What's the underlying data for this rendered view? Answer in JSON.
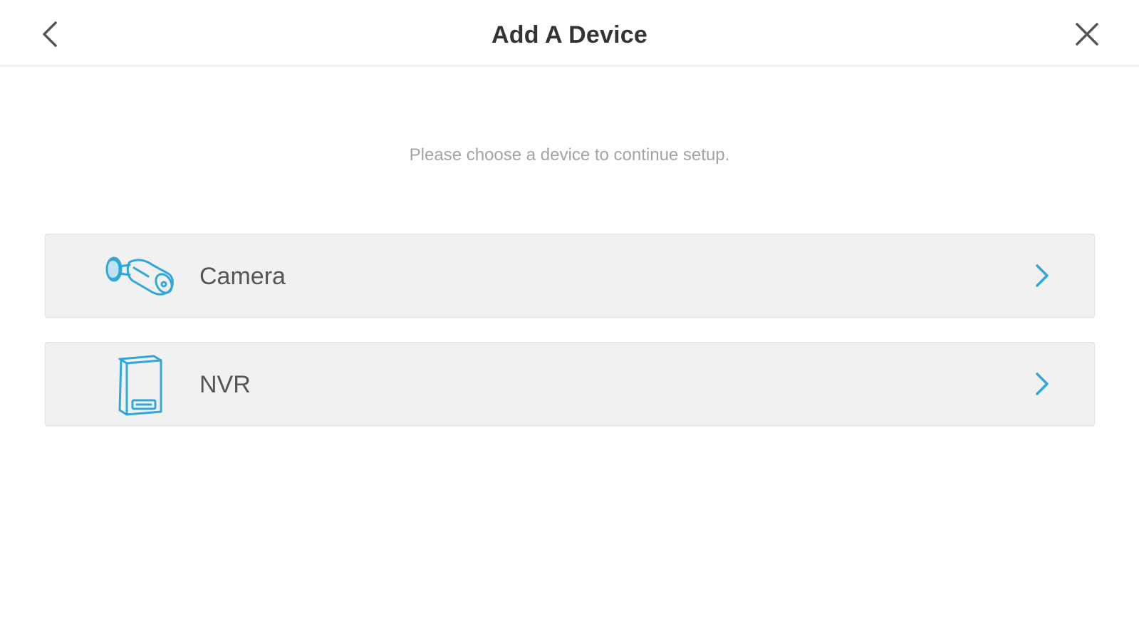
{
  "header": {
    "title": "Add A Device",
    "back_icon": "chevron-left-icon",
    "close_icon": "close-icon"
  },
  "main": {
    "instruction": "Please choose a device to continue setup.",
    "devices": [
      {
        "label": "Camera",
        "icon": "camera-icon"
      },
      {
        "label": "NVR",
        "icon": "nvr-icon"
      }
    ]
  },
  "colors": {
    "accent": "#2fa8d9",
    "icon_dark": "#555555",
    "item_background": "#f1f1f1",
    "subtitle": "#a3a3a3"
  }
}
